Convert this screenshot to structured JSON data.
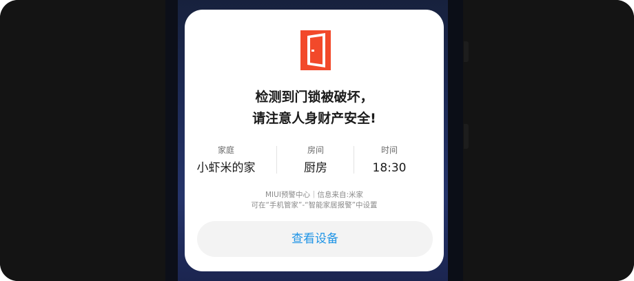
{
  "alert": {
    "icon": "door-open-icon",
    "icon_color": "#f2492a",
    "title_line1": "检测到门锁被破坏，",
    "title_line2": "请注意人身财产安全!"
  },
  "info": {
    "home_label": "家庭",
    "home_value": "小虾米的家",
    "room_label": "房间",
    "room_value": "厨房",
    "time_label": "时间",
    "time_value": "18:30"
  },
  "note": {
    "line1": "MIUI预警中心｜信息来自:米家",
    "line2": "可在“手机管家”-“智能家居报警”中设置"
  },
  "action": {
    "view_device_label": "查看设备",
    "accent_color": "#1f94e6"
  }
}
